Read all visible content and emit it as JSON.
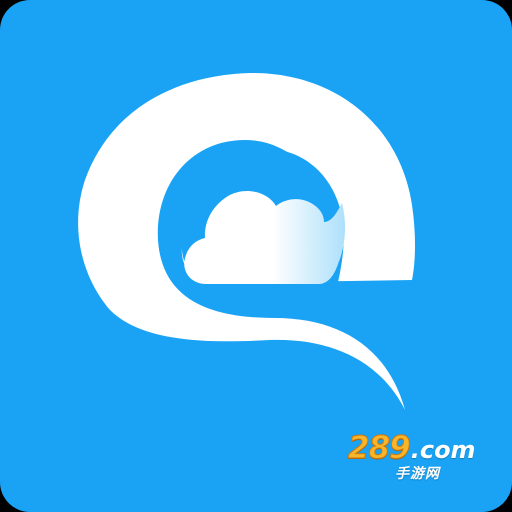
{
  "app_icon": {
    "icon_name": "e-cloud-app-icon",
    "background_color": "#1aa3f5",
    "glyph_color": "#ffffff",
    "cloud_gradient": [
      "#ffffff",
      "#aee0fb"
    ]
  },
  "watermark": {
    "digits": "289",
    "dotcom": ".com",
    "subtitle": "手游网",
    "digits_color": "#f7b52b"
  }
}
